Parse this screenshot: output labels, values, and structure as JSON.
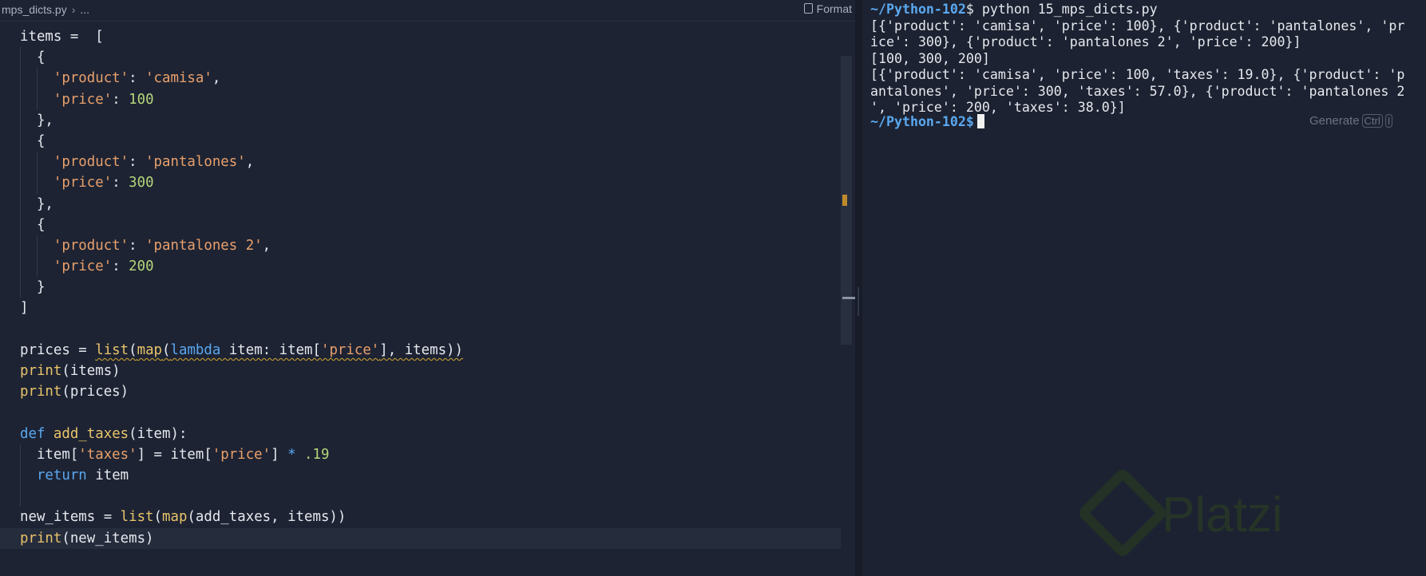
{
  "editor": {
    "breadcrumb": {
      "file": "mps_dicts.py",
      "separator": "›",
      "more": "..."
    },
    "format_label": "Format",
    "active_line": 25,
    "lines": [
      [
        [
          "items =  [",
          "op"
        ]
      ],
      [
        [
          "  {",
          "op"
        ]
      ],
      [
        [
          "    ",
          "op"
        ],
        [
          "'product'",
          "str"
        ],
        [
          ": ",
          "op"
        ],
        [
          "'camisa'",
          "str"
        ],
        [
          ",",
          "op"
        ]
      ],
      [
        [
          "    ",
          "op"
        ],
        [
          "'price'",
          "str"
        ],
        [
          ": ",
          "op"
        ],
        [
          "100",
          "num"
        ]
      ],
      [
        [
          "  },",
          "op"
        ]
      ],
      [
        [
          "  {",
          "op"
        ]
      ],
      [
        [
          "    ",
          "op"
        ],
        [
          "'product'",
          "str"
        ],
        [
          ": ",
          "op"
        ],
        [
          "'pantalones'",
          "str"
        ],
        [
          ",",
          "op"
        ]
      ],
      [
        [
          "    ",
          "op"
        ],
        [
          "'price'",
          "str"
        ],
        [
          ": ",
          "op"
        ],
        [
          "300",
          "num"
        ]
      ],
      [
        [
          "  },",
          "op"
        ]
      ],
      [
        [
          "  {",
          "op"
        ]
      ],
      [
        [
          "    ",
          "op"
        ],
        [
          "'product'",
          "str"
        ],
        [
          ": ",
          "op"
        ],
        [
          "'pantalones 2'",
          "str"
        ],
        [
          ",",
          "op"
        ]
      ],
      [
        [
          "    ",
          "op"
        ],
        [
          "'price'",
          "str"
        ],
        [
          ": ",
          "op"
        ],
        [
          "200",
          "num"
        ]
      ],
      [
        [
          "  }",
          "op"
        ]
      ],
      [
        [
          "]",
          "op"
        ]
      ],
      [],
      [
        [
          "prices = ",
          "op"
        ],
        [
          "list",
          "fn sq"
        ],
        [
          "(",
          "op sq"
        ],
        [
          "map",
          "fn sq"
        ],
        [
          "(",
          "op sq"
        ],
        [
          "lambda",
          "kw sq"
        ],
        [
          " item: item[",
          "op sq"
        ],
        [
          "'price'",
          "str sq"
        ],
        [
          "], items))",
          "op sq"
        ]
      ],
      [
        [
          "print",
          "fn"
        ],
        [
          "(items)",
          "op"
        ]
      ],
      [
        [
          "print",
          "fn"
        ],
        [
          "(prices)",
          "op"
        ]
      ],
      [],
      [
        [
          "def",
          "kw"
        ],
        [
          " ",
          "op"
        ],
        [
          "add_taxes",
          "fn"
        ],
        [
          "(item):",
          "op"
        ]
      ],
      [
        [
          "  item[",
          "op"
        ],
        [
          "'taxes'",
          "str"
        ],
        [
          "] = item[",
          "op"
        ],
        [
          "'price'",
          "str"
        ],
        [
          "] ",
          "op"
        ],
        [
          "*",
          "kw"
        ],
        [
          " ",
          "op"
        ],
        [
          ".19",
          "num"
        ]
      ],
      [
        [
          "  ",
          "op"
        ],
        [
          "return",
          "kw"
        ],
        [
          " item",
          "op"
        ]
      ],
      [],
      [
        [
          "new_items = ",
          "op"
        ],
        [
          "list",
          "fn"
        ],
        [
          "(",
          "op"
        ],
        [
          "map",
          "fn"
        ],
        [
          "(add_taxes, items))",
          "op"
        ]
      ],
      [
        [
          "print",
          "fn"
        ],
        [
          "(new_items)",
          "op"
        ]
      ]
    ]
  },
  "terminal": {
    "prompt": "~/Python-102",
    "command": "$ python 15_mps_dicts.py",
    "output": [
      "[{'product': 'camisa', 'price': 100}, {'product': 'pantalones', 'pr",
      "ice': 300}, {'product': 'pantalones 2', 'price': 200}]",
      "[100, 300, 200]",
      "[{'product': 'camisa', 'price': 100, 'taxes': 19.0}, {'product': 'p",
      "antalones', 'price': 300, 'taxes': 57.0}, {'product': 'pantalones 2",
      "', 'price': 200, 'taxes': 38.0}]"
    ],
    "prompt2": "~/Python-102",
    "prompt2_suffix": "$",
    "generate_label": "Generate",
    "generate_keys": [
      "Ctrl",
      "I"
    ]
  },
  "watermark": "Platzi"
}
